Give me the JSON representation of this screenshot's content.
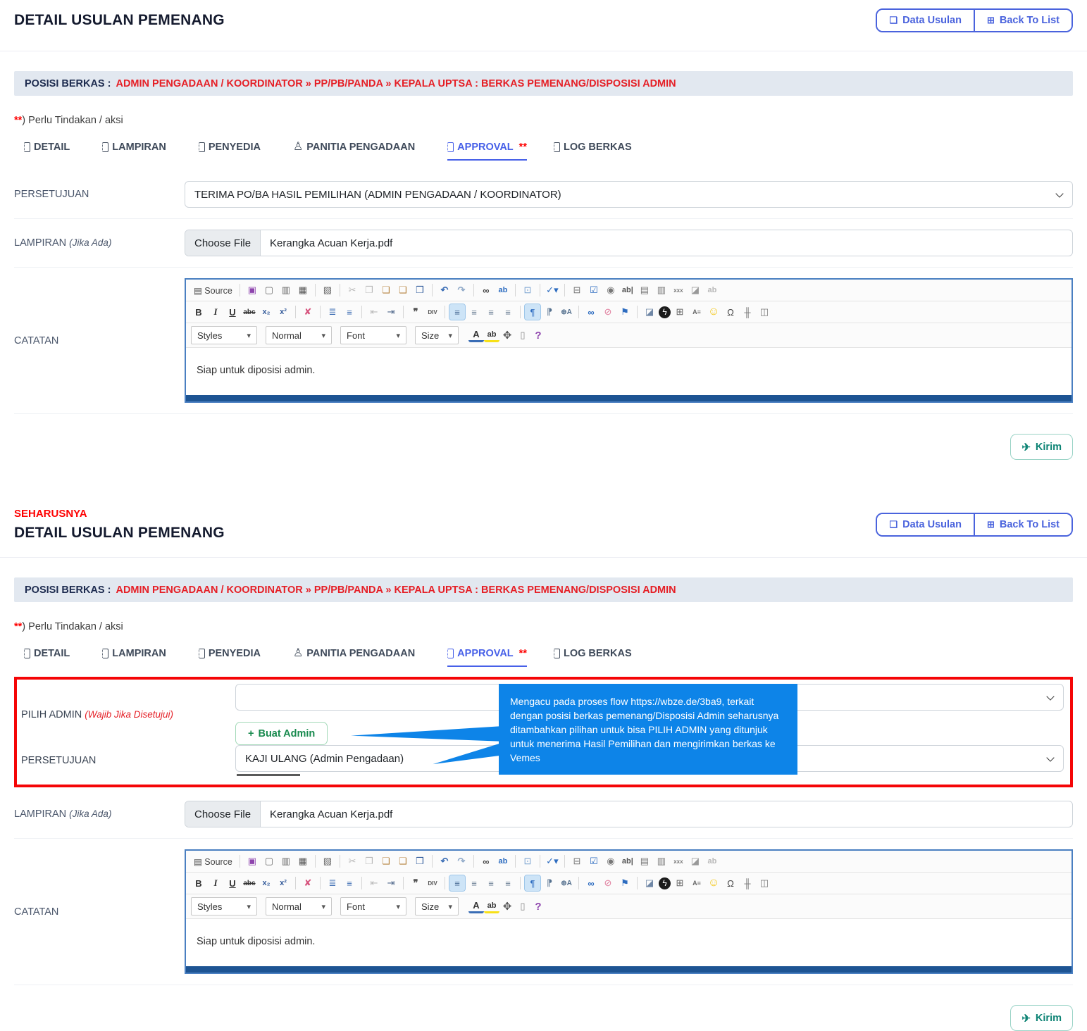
{
  "header": {
    "title": "DETAIL USULAN PEMENANG",
    "actions": [
      {
        "name": "data-usulan-button",
        "g": "❏",
        "label": "Data Usulan"
      },
      {
        "name": "back-to-list-button",
        "g": "⊞",
        "label": "Back To List"
      }
    ]
  },
  "seharusnya": "SEHARUSNYA",
  "posisi": {
    "label": "POSISI BERKAS :",
    "value": "ADMIN PENGADAAN / KOORDINATOR » PP/PB/PANDA » KEPALA UPTSA : BERKAS PEMENANG/DISPOSISI ADMIN"
  },
  "note": {
    "stars": "**",
    "text": ") Perlu Tindakan / aksi"
  },
  "tabs": [
    {
      "name": "tab-detail",
      "label": "DETAIL",
      "icls": "boxico"
    },
    {
      "name": "tab-lampiran",
      "label": "LAMPIRAN",
      "icls": "boxico"
    },
    {
      "name": "tab-penyedia",
      "label": "PENYEDIA",
      "icls": "boxico"
    },
    {
      "name": "tab-panitia-pengadaan",
      "label": "PANITIA PENGADAAN",
      "icls": "pglyph",
      "ig": "♙"
    },
    {
      "name": "tab-approval",
      "label": "APPROVAL",
      "icls": "boxico",
      "cls": "active",
      "badge": "**"
    },
    {
      "name": "tab-log-berkas",
      "label": "LOG BERKAS",
      "icls": "boxico"
    }
  ],
  "form": {
    "persetujuan_label": "PERSETUJUAN",
    "persetujuan_value": "TERIMA PO/BA HASIL PEMILIHAN (ADMIN PENGADAAN / KOORDINATOR)",
    "lampiran_label": "LAMPIRAN",
    "lampiran_hint": "(Jika Ada)",
    "choose_file": "Choose File",
    "filename": "Kerangka Acuan Kerja.pdf",
    "catatan_label": "CATATAN",
    "kirim_label": "Kirim",
    "kirim_icon": "✈"
  },
  "admin": {
    "pilih_label": "PILIH ADMIN",
    "pilih_hint": "(Wajib Jika Disetujui)",
    "buat_plus": "+",
    "buat_label": "Buat Admin",
    "persetujuan_label": "PERSETUJUAN",
    "persetujuan_value": "KAJI ULANG (Admin Pengadaan)",
    "callout": "Mengacu pada proses flow https://wbze.de/3ba9, terkait dengan posisi berkas pemenang/Disposisi Admin seharusnya ditambahkan pilihan untuk bisa PILIH ADMIN yang ditunjuk untuk menerima Hasil Pemilihan dan mengirimkan berkas ke Vemes"
  },
  "editor": {
    "content": "Siap untuk diposisi admin.",
    "row1": [
      {
        "n": "source-button",
        "g": "▤ Source",
        "cls": "src"
      },
      {
        "n": "separator",
        "cls": "sep",
        "int": "false"
      },
      {
        "n": "save-icon",
        "g": "▣",
        "st": "color:#8e44ad"
      },
      {
        "n": "new-page-icon",
        "g": "▢",
        "st": "color:#666"
      },
      {
        "n": "preview-icon",
        "g": "▥",
        "st": "color:#666"
      },
      {
        "n": "print-icon",
        "g": "▦",
        "st": "color:#555"
      },
      {
        "n": "separator",
        "cls": "sep",
        "int": "false"
      },
      {
        "n": "templates-icon",
        "g": "▧",
        "st": "color:#666"
      },
      {
        "n": "separator",
        "cls": "sep",
        "int": "false"
      },
      {
        "n": "cut-icon",
        "g": "✂",
        "cls": "dis"
      },
      {
        "n": "copy-icon",
        "g": "❐",
        "cls": "dis"
      },
      {
        "n": "paste-icon",
        "g": "❏",
        "st": "color:#b5823c"
      },
      {
        "n": "paste-text-icon",
        "g": "❑",
        "st": "color:#b5823c"
      },
      {
        "n": "paste-word-icon",
        "g": "❒",
        "st": "color:#2b579a"
      },
      {
        "n": "separator",
        "cls": "sep",
        "int": "false"
      },
      {
        "n": "undo-icon",
        "g": "↶",
        "st": "color:#3a6db5;font-weight:700"
      },
      {
        "n": "redo-icon",
        "g": "↷",
        "st": "color:#92abc9;font-weight:700"
      },
      {
        "n": "separator",
        "cls": "sep",
        "int": "false"
      },
      {
        "n": "find-icon",
        "g": "∞",
        "st": "color:#444;font-weight:700"
      },
      {
        "n": "replace-icon",
        "g": "ab",
        "cls": "txt",
        "st": "color:#2d6cc0"
      },
      {
        "n": "separator",
        "cls": "sep",
        "int": "false"
      },
      {
        "n": "select-all-icon",
        "g": "⊡",
        "st": "color:#7ba3d0"
      },
      {
        "n": "separator",
        "cls": "sep",
        "int": "false"
      },
      {
        "n": "spellcheck-icon",
        "g": "✓▾",
        "st": "color:#2d6cc0"
      },
      {
        "n": "separator",
        "cls": "sep",
        "int": "false"
      },
      {
        "n": "form-icon",
        "g": "⊟",
        "st": "color:#777"
      },
      {
        "n": "checkbox-icon",
        "g": "☑",
        "st": "color:#2d6cc0"
      },
      {
        "n": "radio-icon",
        "g": "◉",
        "st": "color:#777"
      },
      {
        "n": "text-field-icon",
        "g": "ab|",
        "cls": "txt",
        "st": "color:#555"
      },
      {
        "n": "textarea-icon",
        "g": "▤",
        "st": "color:#777"
      },
      {
        "n": "select-field-icon",
        "g": "▥",
        "st": "color:#777"
      },
      {
        "n": "button-icon",
        "g": "xxx",
        "cls": "txt",
        "st": "color:#777;font-size:8px"
      },
      {
        "n": "image-button-icon",
        "g": "◪",
        "st": "color:#999"
      },
      {
        "n": "hidden-field-icon",
        "g": "ab",
        "cls": "txt dis"
      }
    ],
    "row2": [
      {
        "n": "bold-icon",
        "g": "B",
        "cls": "txt",
        "st": "font-weight:800;color:#333;font-size:13px"
      },
      {
        "n": "italic-icon",
        "g": "I",
        "cls": "txt ital",
        "st": "color:#333"
      },
      {
        "n": "underline-icon",
        "g": "U",
        "cls": "txt",
        "st": "text-decoration:underline;color:#333;font-size:13px"
      },
      {
        "n": "strike-icon",
        "g": "abc",
        "cls": "txt",
        "st": "text-decoration:line-through;color:#333;font-size:10px"
      },
      {
        "n": "subscript-icon",
        "g": "x₂",
        "cls": "txt",
        "st": "color:#335a9a"
      },
      {
        "n": "superscript-icon",
        "g": "x²",
        "cls": "txt",
        "st": "color:#335a9a"
      },
      {
        "n": "separator",
        "cls": "sep",
        "int": "false"
      },
      {
        "n": "remove-format-icon",
        "g": "✘",
        "st": "color:#d6527c"
      },
      {
        "n": "separator",
        "cls": "sep",
        "int": "false"
      },
      {
        "n": "numbered-list-icon",
        "g": "≣",
        "st": "color:#3d6db3"
      },
      {
        "n": "bulleted-list-icon",
        "g": "≡",
        "st": "color:#3d6db3"
      },
      {
        "n": "separator",
        "cls": "sep",
        "int": "false"
      },
      {
        "n": "outdent-icon",
        "g": "⇤",
        "cls": "dis"
      },
      {
        "n": "indent-icon",
        "g": "⇥",
        "st": "color:#51698c"
      },
      {
        "n": "separator",
        "cls": "sep",
        "int": "false"
      },
      {
        "n": "blockquote-icon",
        "g": "❞",
        "st": "color:#555;font-weight:700"
      },
      {
        "n": "div-icon",
        "g": "DIV",
        "cls": "txt",
        "st": "color:#555;font-size:8px"
      },
      {
        "n": "separator",
        "cls": "sep",
        "int": "false"
      },
      {
        "n": "align-left-icon",
        "g": "≡",
        "cls": "act",
        "st": "color:#4a6d96"
      },
      {
        "n": "align-center-icon",
        "g": "≡",
        "st": "color:#6b7f95"
      },
      {
        "n": "align-right-icon",
        "g": "≡",
        "st": "color:#6b7f95"
      },
      {
        "n": "align-justify-icon",
        "g": "≡",
        "st": "color:#6b7f95"
      },
      {
        "n": "separator",
        "cls": "sep",
        "int": "false"
      },
      {
        "n": "ltr-icon",
        "g": "¶",
        "cls": "act",
        "st": "color:#2d6cc0"
      },
      {
        "n": "rtl-icon",
        "g": "⁋",
        "st": "color:#55718f"
      },
      {
        "n": "language-icon",
        "g": "⊕A",
        "cls": "txt",
        "st": "color:#55718f;font-size:10px"
      },
      {
        "n": "separator",
        "cls": "sep",
        "int": "false"
      },
      {
        "n": "link-icon",
        "g": "∞",
        "st": "color:#2d6cc0;font-weight:700"
      },
      {
        "n": "unlink-icon",
        "g": "⊘",
        "st": "color:#e07d9d"
      },
      {
        "n": "anchor-icon",
        "g": "⚑",
        "st": "color:#2d6cc0"
      },
      {
        "n": "separator",
        "cls": "sep",
        "int": "false"
      },
      {
        "n": "image-icon",
        "g": "◪",
        "st": "color:#6f87a6"
      },
      {
        "n": "flash-icon",
        "g": "ϟ",
        "cls": "circ"
      },
      {
        "n": "table-icon",
        "g": "⊞",
        "st": "color:#666"
      },
      {
        "n": "horizontal-line-icon",
        "g": "A≡",
        "cls": "txt",
        "st": "color:#666;font-size:9px"
      },
      {
        "n": "smiley-icon",
        "g": "☺",
        "st": "color:#f2c40e;font-size:16px"
      },
      {
        "n": "special-char-icon",
        "g": "Ω",
        "st": "color:#444"
      },
      {
        "n": "page-break-icon",
        "g": "╫",
        "st": "color:#777"
      },
      {
        "n": "iframe-icon",
        "g": "◫",
        "st": "color:#777"
      }
    ],
    "row3_dropdowns": [
      {
        "dn": "styles-dropdown",
        "label": "Styles",
        "st": "width:94px"
      },
      {
        "dn": "format-dropdown",
        "label": "Normal",
        "st": "width:94px"
      },
      {
        "dn": "font-dropdown",
        "label": "Font",
        "st": "width:94px"
      },
      {
        "dn": "size-dropdown",
        "label": "Size",
        "st": "width:62px"
      }
    ],
    "row3_icons": [
      {
        "n": "text-color-icon",
        "g": "A",
        "cls": "txt tcol"
      },
      {
        "n": "bg-color-icon",
        "g": "ab",
        "cls": "txt bcol"
      },
      {
        "n": "maximize-icon",
        "g": "✥",
        "st": "color:#555;font-size:15px"
      },
      {
        "n": "show-blocks-icon",
        "g": "▯",
        "st": "color:#888"
      },
      {
        "n": "about-icon",
        "g": "?",
        "cls": "txt",
        "st": "color:#8e44ad;font-size:15px"
      }
    ]
  },
  "colors": {
    "accent_blue": "#4a63dd",
    "active_tab_blue": "#4760e8",
    "posisi_red": "#e51f26",
    "annotation_red": "#f50506",
    "callout_blue": "#0d84e8",
    "kirim_teal": "#0c8374",
    "buat_admin_green": "#188a4e",
    "editor_border": "#4a7fc1",
    "editor_bottom_bar": "#1d5493",
    "posisi_bar_bg": "#e2e8f0"
  }
}
